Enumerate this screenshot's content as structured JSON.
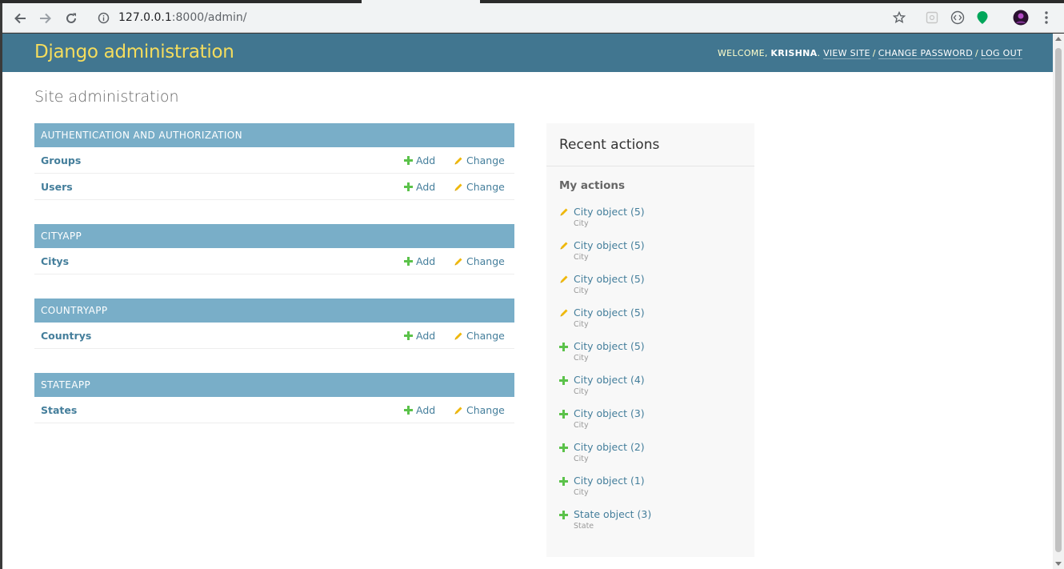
{
  "browser": {
    "url_host": "127.0.0.1",
    "url_rest": ":8000/admin/"
  },
  "header": {
    "branding": "Django administration",
    "welcome": "WELCOME,",
    "username": "KRISHNA",
    "view_site": "VIEW SITE",
    "change_password": "CHANGE PASSWORD",
    "log_out": "LOG OUT",
    "sep": "/"
  },
  "page_title": "Site administration",
  "labels": {
    "add": "Add",
    "change": "Change"
  },
  "modules": [
    {
      "caption": "AUTHENTICATION AND AUTHORIZATION",
      "models": [
        "Groups",
        "Users"
      ]
    },
    {
      "caption": "CITYAPP",
      "models": [
        "Citys"
      ]
    },
    {
      "caption": "COUNTRYAPP",
      "models": [
        "Countrys"
      ]
    },
    {
      "caption": "STATEAPP",
      "models": [
        "States"
      ]
    }
  ],
  "recent": {
    "title": "Recent actions",
    "subtitle": "My actions",
    "items": [
      {
        "name": "City object (5)",
        "type": "City",
        "action": "change"
      },
      {
        "name": "City object (5)",
        "type": "City",
        "action": "change"
      },
      {
        "name": "City object (5)",
        "type": "City",
        "action": "change"
      },
      {
        "name": "City object (5)",
        "type": "City",
        "action": "change"
      },
      {
        "name": "City object (5)",
        "type": "City",
        "action": "add"
      },
      {
        "name": "City object (4)",
        "type": "City",
        "action": "add"
      },
      {
        "name": "City object (3)",
        "type": "City",
        "action": "add"
      },
      {
        "name": "City object (2)",
        "type": "City",
        "action": "add"
      },
      {
        "name": "City object (1)",
        "type": "City",
        "action": "add"
      },
      {
        "name": "State object (3)",
        "type": "State",
        "action": "add"
      }
    ]
  },
  "colors": {
    "header_bg": "#417690",
    "branding": "#f5dd5d",
    "caption_bg": "#79aec8",
    "link": "#447e9b",
    "add_icon": "#5bc24a",
    "change_icon": "#efb80b"
  }
}
